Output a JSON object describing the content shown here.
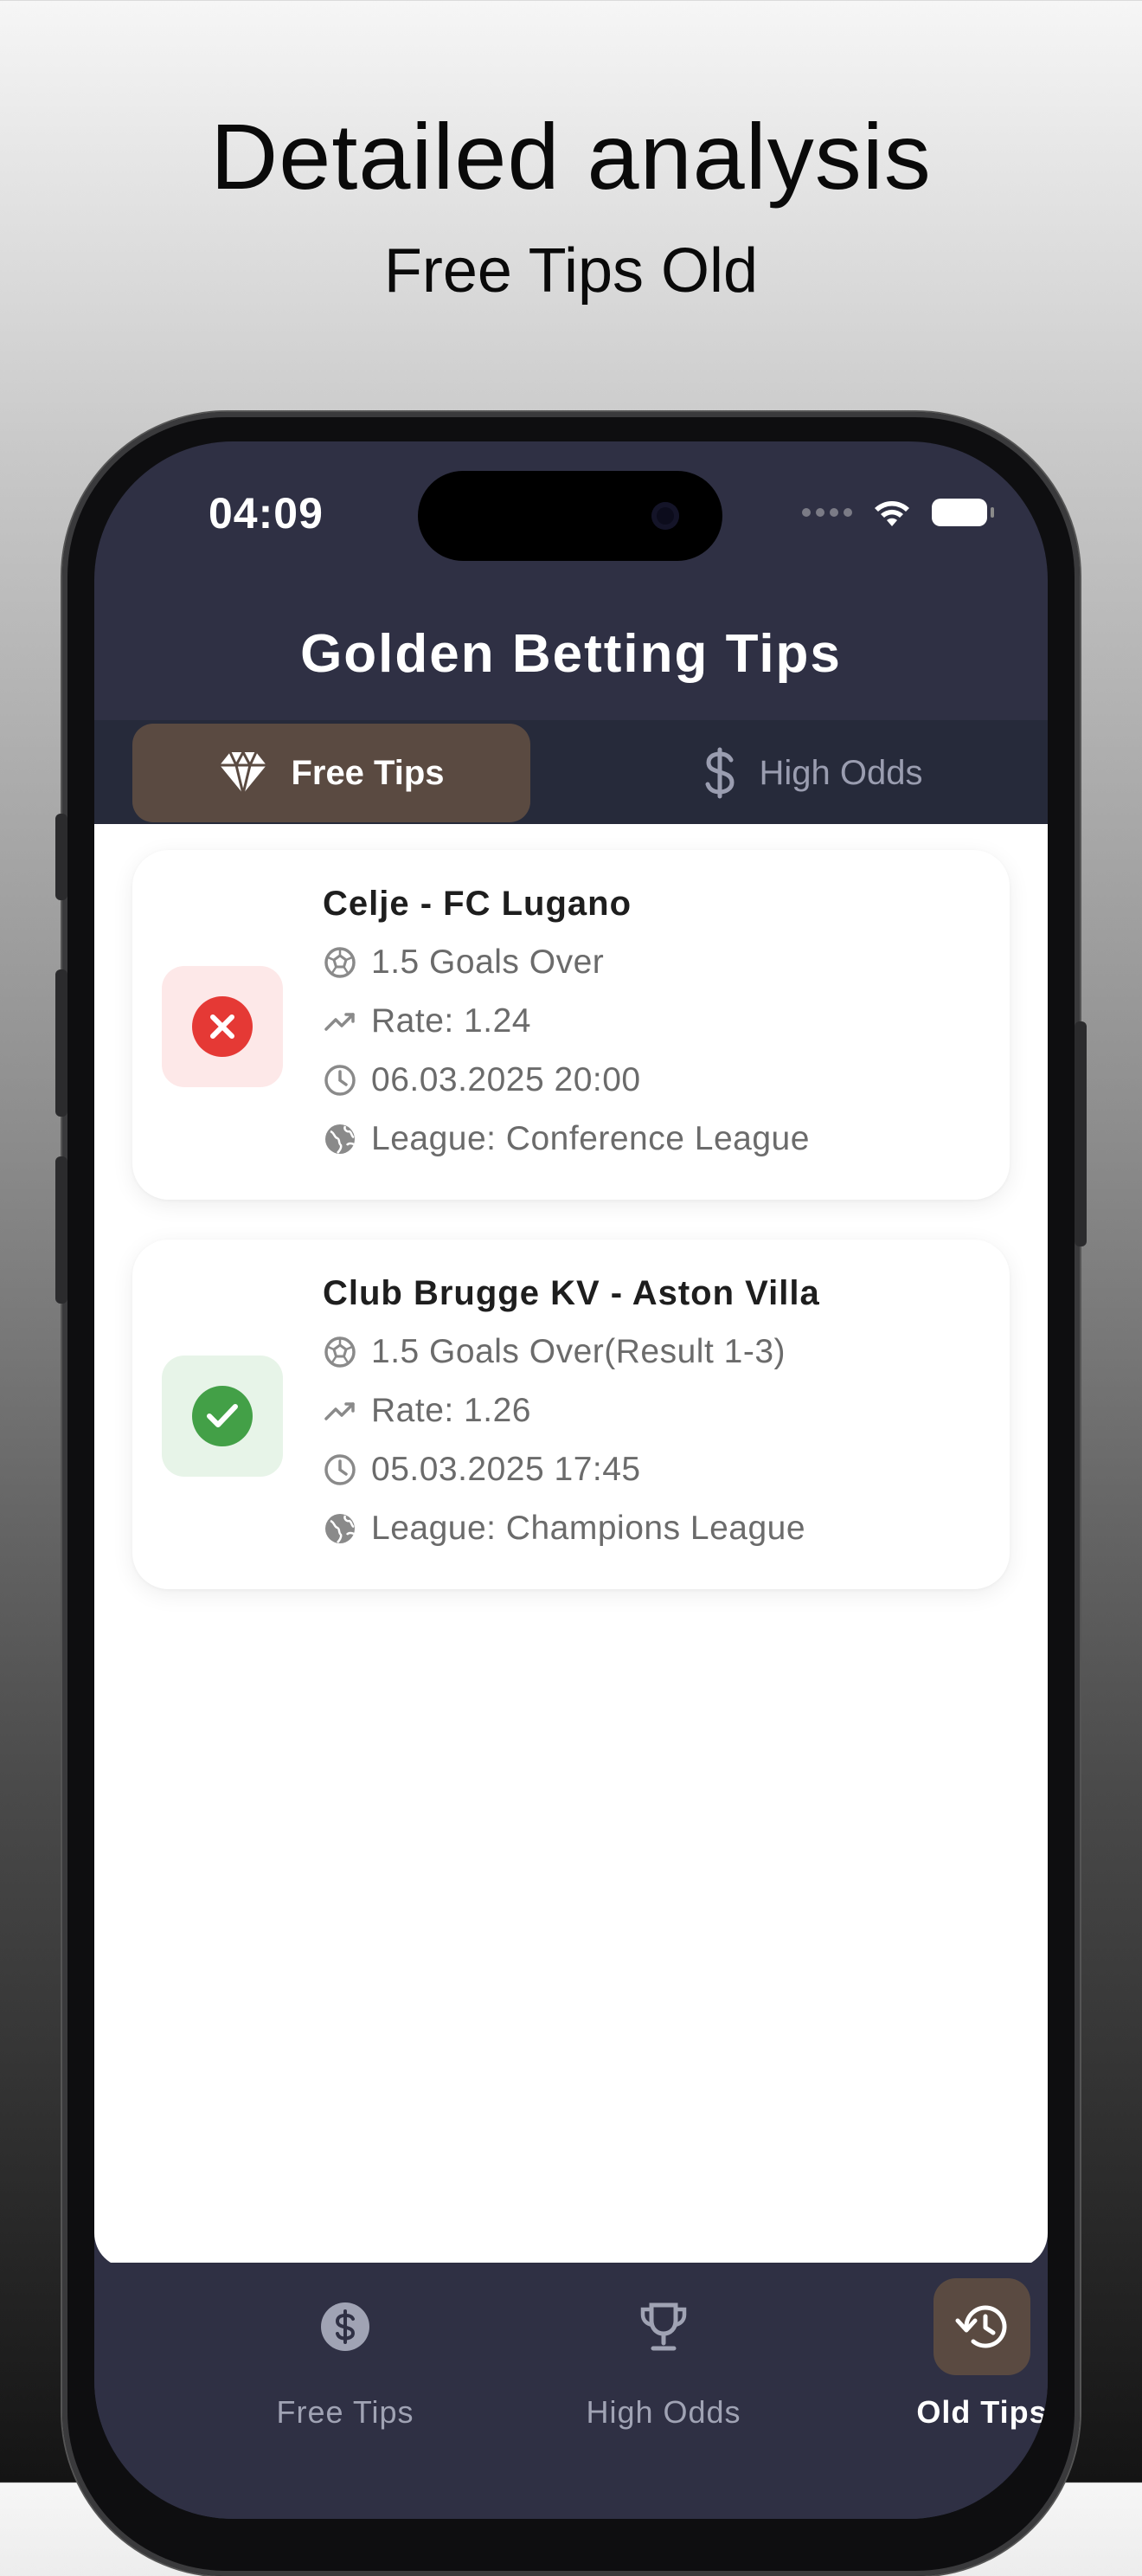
{
  "promo": {
    "title": "Detailed analysis",
    "subtitle": "Free Tips Old"
  },
  "status_bar": {
    "time": "04:09",
    "icons": [
      "signal-dots-icon",
      "wifi-icon",
      "battery-icon"
    ]
  },
  "app": {
    "title": "Golden Betting Tips"
  },
  "top_tabs": [
    {
      "label": "Free Tips",
      "icon": "diamond-icon",
      "active": true
    },
    {
      "label": "High Odds",
      "icon": "dollar-icon",
      "active": false
    }
  ],
  "tips": [
    {
      "match": "Celje - FC Lugano",
      "result": "lost",
      "result_icon": "close-icon",
      "prediction": "1.5 Goals Over",
      "rate": "Rate: 1.24",
      "datetime": "06.03.2025 20:00",
      "league": "League: Conference League"
    },
    {
      "match": "Club Brugge KV - Aston Villa",
      "result": "won",
      "result_icon": "check-icon",
      "prediction": "1.5 Goals Over(Result 1-3)",
      "rate": "Rate: 1.26",
      "datetime": "05.03.2025 17:45",
      "league": "League: Champions League"
    }
  ],
  "bottom_nav": [
    {
      "label": "Free Tips",
      "icon": "dollar-circle-icon",
      "active": false
    },
    {
      "label": "High Odds",
      "icon": "trophy-icon",
      "active": false
    },
    {
      "label": "Old Tips",
      "icon": "history-icon",
      "active": true
    }
  ],
  "colors": {
    "header_bg": "#2f3044",
    "active_tab_bg": "#5a4a41",
    "lost": "#e53935",
    "won": "#43a047"
  }
}
